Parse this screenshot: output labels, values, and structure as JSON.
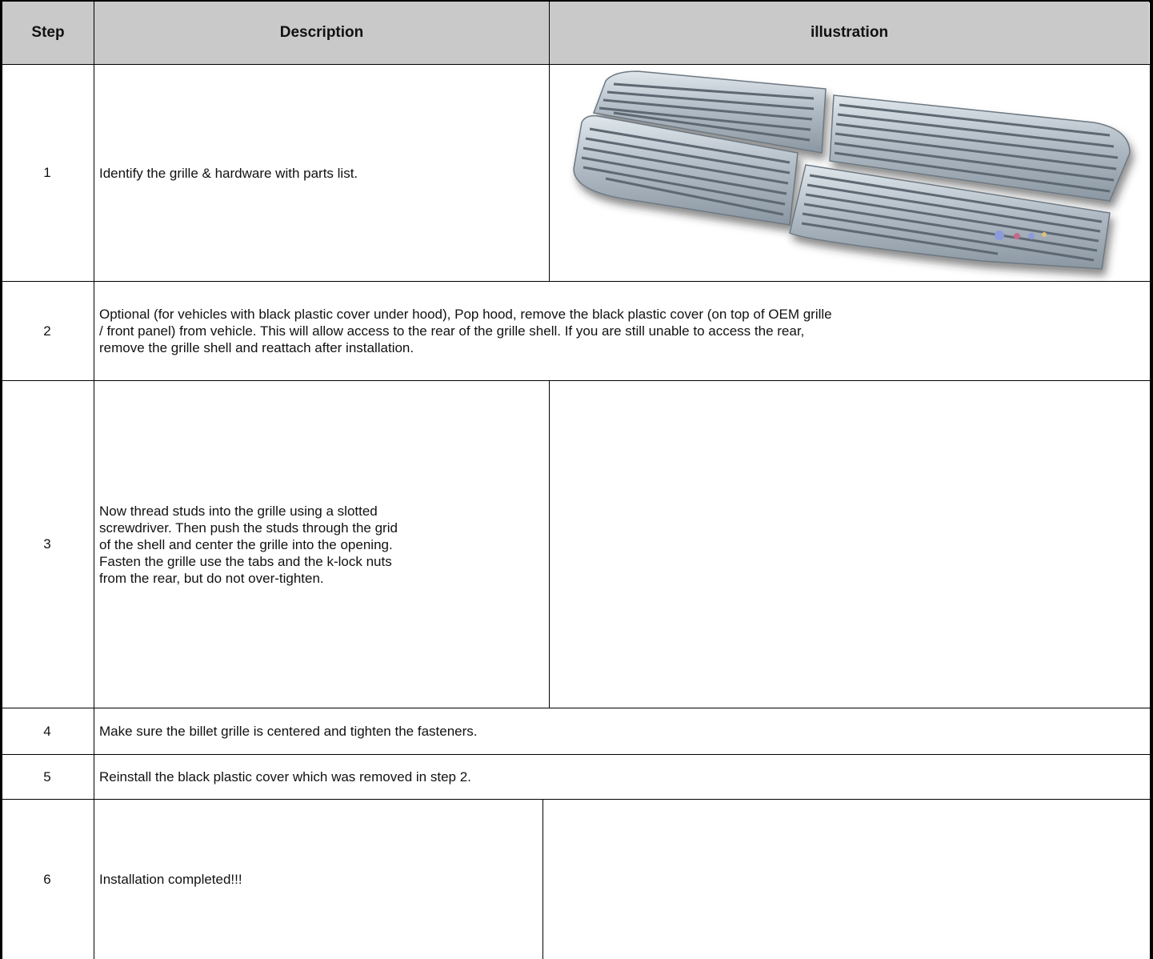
{
  "table": {
    "headers": {
      "step": "Step",
      "description": "Description",
      "illustration": "illustration"
    },
    "rows": [
      {
        "step": "1",
        "description": "Identify the grille & hardware with parts list."
      },
      {
        "step": "2",
        "description": "Optional (for vehicles with black plastic cover under hood), Pop hood, remove the black plastic cover (on top of OEM grille\n/ front panel) from vehicle. This will allow access to the rear of the grille shell. If you are still unable to access the rear,\nremove the grille shell and reattach after installation."
      },
      {
        "step": "3",
        "description": "Now thread studs into the grille using a slotted\nscrewdriver. Then push the studs through the grid\nof the shell and center the grille into the opening.\nFasten the grille use the tabs and the k-lock nuts\nfrom the rear, but do not over-tighten."
      },
      {
        "step": "4",
        "description": "Make sure the billet grille is centered and tighten the fasteners."
      },
      {
        "step": "5",
        "description": "Reinstall the black plastic cover which was removed in step 2."
      },
      {
        "step": "6",
        "description": "Installation completed!!!"
      }
    ]
  },
  "colors": {
    "header_bg": "#c9c9c9",
    "border": "#000000",
    "grille_metal": "#b9c3cc"
  }
}
